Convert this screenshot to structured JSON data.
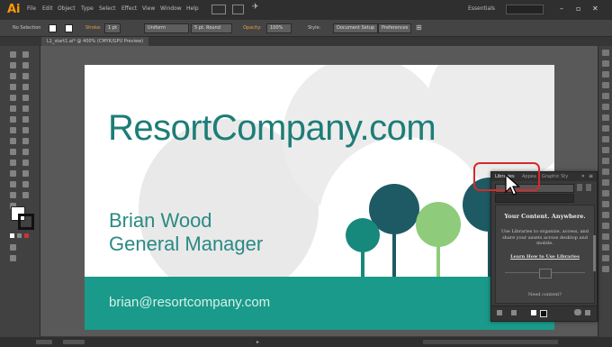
{
  "app": {
    "logo": "Ai",
    "workspace": "Essentials",
    "window_minimize": "–",
    "window_restore": "▫",
    "window_close": "✕"
  },
  "menu": [
    "File",
    "Edit",
    "Object",
    "Type",
    "Select",
    "Effect",
    "View",
    "Window",
    "Help"
  ],
  "control_bar": {
    "selection": "No Selection",
    "stroke_label": "Stroke:",
    "stroke_width": "1 pt",
    "uniform": "Uniform",
    "brush": "5 pt. Round",
    "opacity_label": "Opacity:",
    "opacity_value": "100%",
    "style_label": "Style:",
    "document_setup": "Document Setup",
    "preferences": "Preferences"
  },
  "document_tab": "L1_start1.ai* @ 400% (CMYK/GPU Preview)",
  "card": {
    "title": "ResortCompany.com",
    "name": "Brian Wood",
    "role": "General Manager",
    "email": "brian@resortcompany.com"
  },
  "libraries_panel": {
    "tabs": [
      "Libraries",
      "Appea",
      "Graphic Sty"
    ],
    "heading": "Your Content. Anywhere.",
    "body": "Use Libraries to organize, access, and share your assets across desktop and mobile.",
    "link": "Learn How to Use Libraries",
    "need_content": "Need content?"
  },
  "colors": {
    "teal_text": "#1d7d77",
    "band": "#1a9a8a",
    "highlight": "#d62a2a",
    "app_bg": "#3c3c3c"
  }
}
